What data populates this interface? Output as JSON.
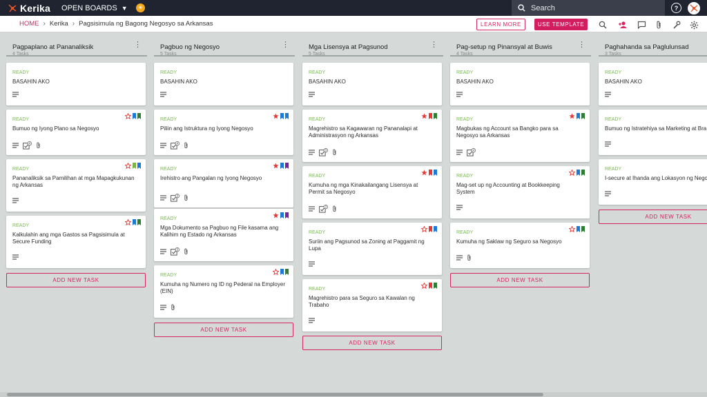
{
  "app": {
    "name": "Kerika",
    "open_boards": "OPEN BOARDS"
  },
  "search": {
    "placeholder": "Search"
  },
  "breadcrumb": {
    "home": "HOME",
    "org": "Kerika",
    "board": "Pagsisimula ng Bagong Negosyo sa Arkansas"
  },
  "actions": {
    "learn_more": "LEARN MORE",
    "use_template": "USE TEMPLATE"
  },
  "colors": {
    "accent": "#d21d5e",
    "topbar": "#1f2430",
    "ready": "#76ba4c"
  },
  "columns": [
    {
      "name": "Pagpaplano at Pananaliksik",
      "count": "4 Tasks",
      "add": "ADD NEW TASK",
      "cards": [
        {
          "status": "READY",
          "title": [
            "BASAHIN AKO"
          ],
          "flags": [],
          "icons": [
            "desc"
          ]
        },
        {
          "status": "READY",
          "title": [
            "Bumuo ng Iyong Plano sa Negosyo"
          ],
          "flags": [
            "star-outline",
            "blue",
            "green"
          ],
          "icons": [
            "desc",
            "checklist",
            "attach"
          ],
          "checklist": "4"
        },
        {
          "status": "READY",
          "title": [
            "Pananaliksik sa Pamilihan at mga Mapagkukunan",
            "ng Arkansas"
          ],
          "flags": [
            "star-outline",
            "lime",
            "blue"
          ],
          "icons": [
            "desc"
          ]
        },
        {
          "status": "READY",
          "title": [
            "Kalkulahin ang mga Gastos sa Pagsisimula at",
            "Secure Funding"
          ],
          "flags": [
            "star-outline",
            "blue",
            "green"
          ],
          "icons": [
            "desc"
          ]
        }
      ]
    },
    {
      "name": "Pagbuo ng Negosyo",
      "count": "5 Tasks",
      "add": "ADD NEW TASK",
      "cards": [
        {
          "status": "READY",
          "title": [
            "BASAHIN AKO"
          ],
          "flags": [],
          "icons": [
            "desc"
          ]
        },
        {
          "status": "READY",
          "title": [
            "Piliin ang Istruktura ng Iyong Negosyo"
          ],
          "flags": [
            "star",
            "blue",
            "blue"
          ],
          "icons": [
            "desc",
            "checklist",
            "attach"
          ],
          "checklist": "4"
        },
        {
          "status": "READY",
          "title": [
            "Irehistro ang Pangalan ng Iyong Negosyo"
          ],
          "flags": [
            "star",
            "blue",
            "purple"
          ],
          "icons": [
            "desc",
            "checklist",
            "attach"
          ],
          "checklist": "3"
        },
        {
          "status": "READY",
          "title": [
            "Mga Dokumento sa Pagbuo ng File kasama ang",
            "Kalihim ng Estado ng Arkansas"
          ],
          "flags": [
            "star",
            "blue",
            "purple"
          ],
          "icons": [
            "desc",
            "checklist",
            "attach"
          ],
          "checklist": "3"
        },
        {
          "status": "READY",
          "title": [
            "Kumuha ng Numero ng ID ng Pederal na Employer",
            "(EIN)"
          ],
          "flags": [
            "star-outline",
            "blue",
            "green"
          ],
          "icons": [
            "desc",
            "attach"
          ]
        }
      ]
    },
    {
      "name": "Mga Lisensya at Pagsunod",
      "count": "5 Tasks",
      "add": "ADD NEW TASK",
      "cards": [
        {
          "status": "READY",
          "title": [
            "BASAHIN AKO"
          ],
          "flags": [],
          "icons": [
            "desc"
          ]
        },
        {
          "status": "READY",
          "title": [
            "Magrehistro sa Kagawaran ng Pananalapi at",
            "Administrasyon ng Arkansas"
          ],
          "flags": [
            "star",
            "red",
            "green"
          ],
          "icons": [
            "desc",
            "checklist",
            "attach"
          ],
          "checklist": "3"
        },
        {
          "status": "READY",
          "title": [
            "Kumuha ng mga Kinakailangang Lisensya at",
            "Permit sa Negosyo"
          ],
          "flags": [
            "star",
            "red",
            "blue"
          ],
          "icons": [
            "desc",
            "checklist",
            "attach"
          ],
          "checklist": "3"
        },
        {
          "status": "READY",
          "title": [
            "Suriin ang Pagsunod sa Zoning at Paggamit ng",
            "Lupa"
          ],
          "flags": [
            "star-outline",
            "red",
            "blue"
          ],
          "icons": [
            "desc"
          ]
        },
        {
          "status": "READY",
          "title": [
            "Magrehistro para sa Seguro sa Kawalan ng",
            "Trabaho"
          ],
          "flags": [
            "star-outline",
            "red",
            "green"
          ],
          "icons": [
            "desc"
          ]
        }
      ]
    },
    {
      "name": "Pag-setup ng Pinansyal at Buwis",
      "count": "4 Tasks",
      "add": "ADD NEW TASK",
      "cards": [
        {
          "status": "READY",
          "title": [
            "BASAHIN AKO"
          ],
          "flags": [],
          "icons": [
            "desc"
          ]
        },
        {
          "status": "READY",
          "title": [
            "Magbukas ng Account sa Bangko para sa",
            "Negosyo sa Arkansas"
          ],
          "flags": [
            "star",
            "blue",
            "green"
          ],
          "icons": [
            "desc",
            "checklist"
          ],
          "checklist": "4"
        },
        {
          "status": "READY",
          "title": [
            "Mag-set up ng Accounting at Bookkeeping",
            "System"
          ],
          "flags": [
            "star-outline",
            "blue",
            "green"
          ],
          "icons": [
            "desc"
          ]
        },
        {
          "status": "READY",
          "title": [
            "Kumuha ng Saklaw ng Seguro sa Negosyo"
          ],
          "flags": [
            "star-outline",
            "blue",
            "green"
          ],
          "icons": [
            "desc",
            "attach"
          ]
        }
      ]
    },
    {
      "name": "Paghahanda sa Paglulunsad",
      "count": "3 Tasks",
      "add": "ADD NEW TASK",
      "cards": [
        {
          "status": "READY",
          "title": [
            "BASAHIN AKO"
          ],
          "flags": [],
          "icons": [
            "desc"
          ]
        },
        {
          "status": "READY",
          "title": [
            "Bumuo ng Istratehiya sa Marketing at Bra"
          ],
          "flags": [],
          "icons": [
            "desc"
          ]
        },
        {
          "status": "READY",
          "title": [
            "I-secure at Ihanda ang Lokasyon ng Nego"
          ],
          "flags": [],
          "icons": [
            "desc"
          ]
        }
      ]
    }
  ]
}
